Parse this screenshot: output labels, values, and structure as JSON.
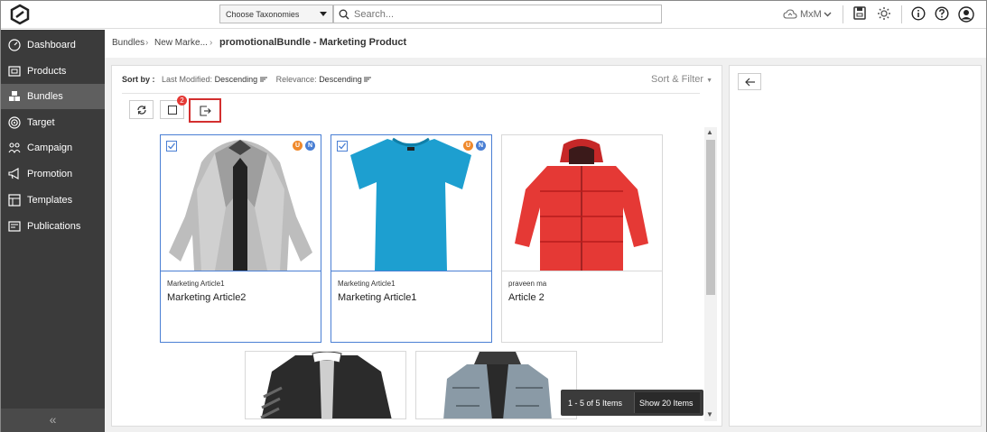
{
  "header": {
    "taxonomy_select": "Choose Taxonomies",
    "search_placeholder": "Search...",
    "user_initials": "MxM"
  },
  "sidebar": {
    "items": [
      {
        "label": "Dashboard",
        "icon": "dashboard-icon"
      },
      {
        "label": "Products",
        "icon": "products-icon"
      },
      {
        "label": "Bundles",
        "icon": "bundles-icon",
        "active": true
      },
      {
        "label": "Target",
        "icon": "target-icon"
      },
      {
        "label": "Campaign",
        "icon": "campaign-icon"
      },
      {
        "label": "Promotion",
        "icon": "megaphone-icon"
      },
      {
        "label": "Templates",
        "icon": "templates-icon"
      },
      {
        "label": "Publications",
        "icon": "publications-icon"
      }
    ],
    "collapse_label": "«"
  },
  "breadcrumb": {
    "items": [
      "Bundles",
      "New Marke..."
    ],
    "separator": "›",
    "title": "promotionalBundle - Marketing Product"
  },
  "sortbar": {
    "label": "Sort by :",
    "field1": "Last Modified:",
    "value1": "Descending",
    "field2": "Relevance:",
    "value2": "Descending",
    "sort_filter": "Sort & Filter"
  },
  "toolbar": {
    "badge_count": "2"
  },
  "cards": [
    {
      "sub": "Marketing Article1",
      "name": "Marketing Article2",
      "selected": true,
      "pills": [
        "U",
        "N"
      ]
    },
    {
      "sub": "Marketing Article1",
      "name": "Marketing Article1",
      "selected": true,
      "pills": [
        "U",
        "N"
      ]
    },
    {
      "sub": "praveen ma",
      "name": "Article 2",
      "selected": false,
      "pills": []
    }
  ],
  "pager": {
    "count": "1 - 5 of 5 Items",
    "show": "Show 20 Items"
  },
  "colors": {
    "sidebar": "#3b3b3b",
    "accent": "#4a7fd4",
    "highlight": "#d32f2f"
  }
}
